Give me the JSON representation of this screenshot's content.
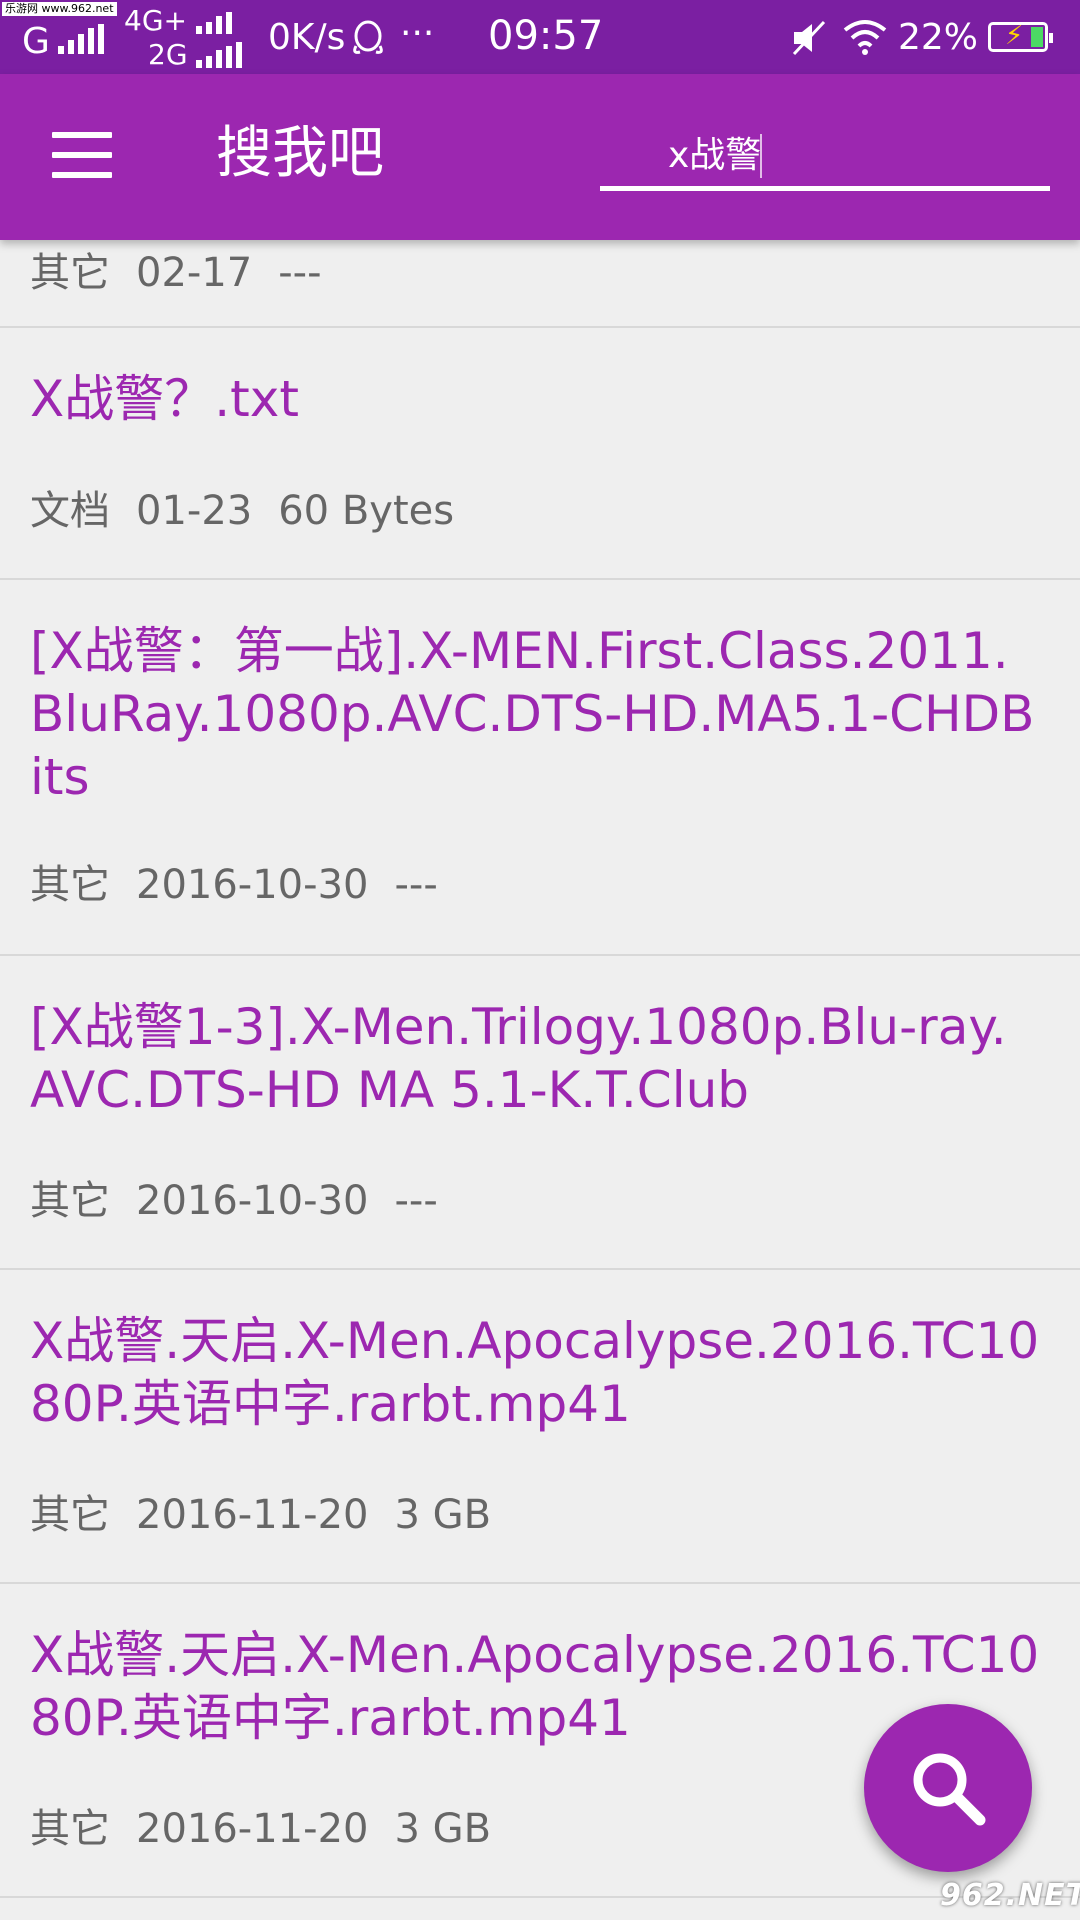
{
  "watermark_top": "乐游网 www.962.net",
  "watermark_bottom": "962.NET",
  "status_bar": {
    "carrier1": "G",
    "carrier2_top": "4G+",
    "carrier2_bottom": "2G",
    "speed": "0K/s",
    "more": "···",
    "time": "09:57",
    "battery": "22%",
    "icons": [
      "signal-icon",
      "qq-icon",
      "mute-icon",
      "wifi-icon",
      "battery-icon"
    ]
  },
  "app_bar": {
    "menu_icon": "hamburger-menu-icon",
    "title": "搜我吧",
    "search_value": "x战警"
  },
  "results": [
    {
      "title": "",
      "type": "其它",
      "date": "02-17",
      "size": "---"
    },
    {
      "title": "X战警？.txt",
      "type": "文档",
      "date": "01-23",
      "size": "60 Bytes"
    },
    {
      "title": "[X战警：第一战].X-MEN.First.Class.2011.BluRay.1080p.AVC.DTS-HD.MA5.1-CHDBits",
      "type": "其它",
      "date": "2016-10-30",
      "size": "---"
    },
    {
      "title": "[X战警1-3].X-Men.Trilogy.1080p.Blu-ray.AVC.DTS-HD MA 5.1-K.T.Club",
      "type": "其它",
      "date": "2016-10-30",
      "size": "---"
    },
    {
      "title": "X战警.天启.X-Men.Apocalypse.2016.TC1080P.英语中字.rarbt.mp41",
      "type": "其它",
      "date": "2016-11-20",
      "size": "3 GB"
    },
    {
      "title": "X战警.天启.X-Men.Apocalypse.2016.TC1080P.英语中字.rarbt.mp41",
      "type": "其它",
      "date": "2016-11-20",
      "size": "3 GB"
    }
  ],
  "fab": {
    "icon": "search-icon"
  },
  "colors": {
    "primary": "#9c27b0",
    "status_bar": "#7b1fa2",
    "background": "#efefef",
    "meta_text": "#666666"
  }
}
